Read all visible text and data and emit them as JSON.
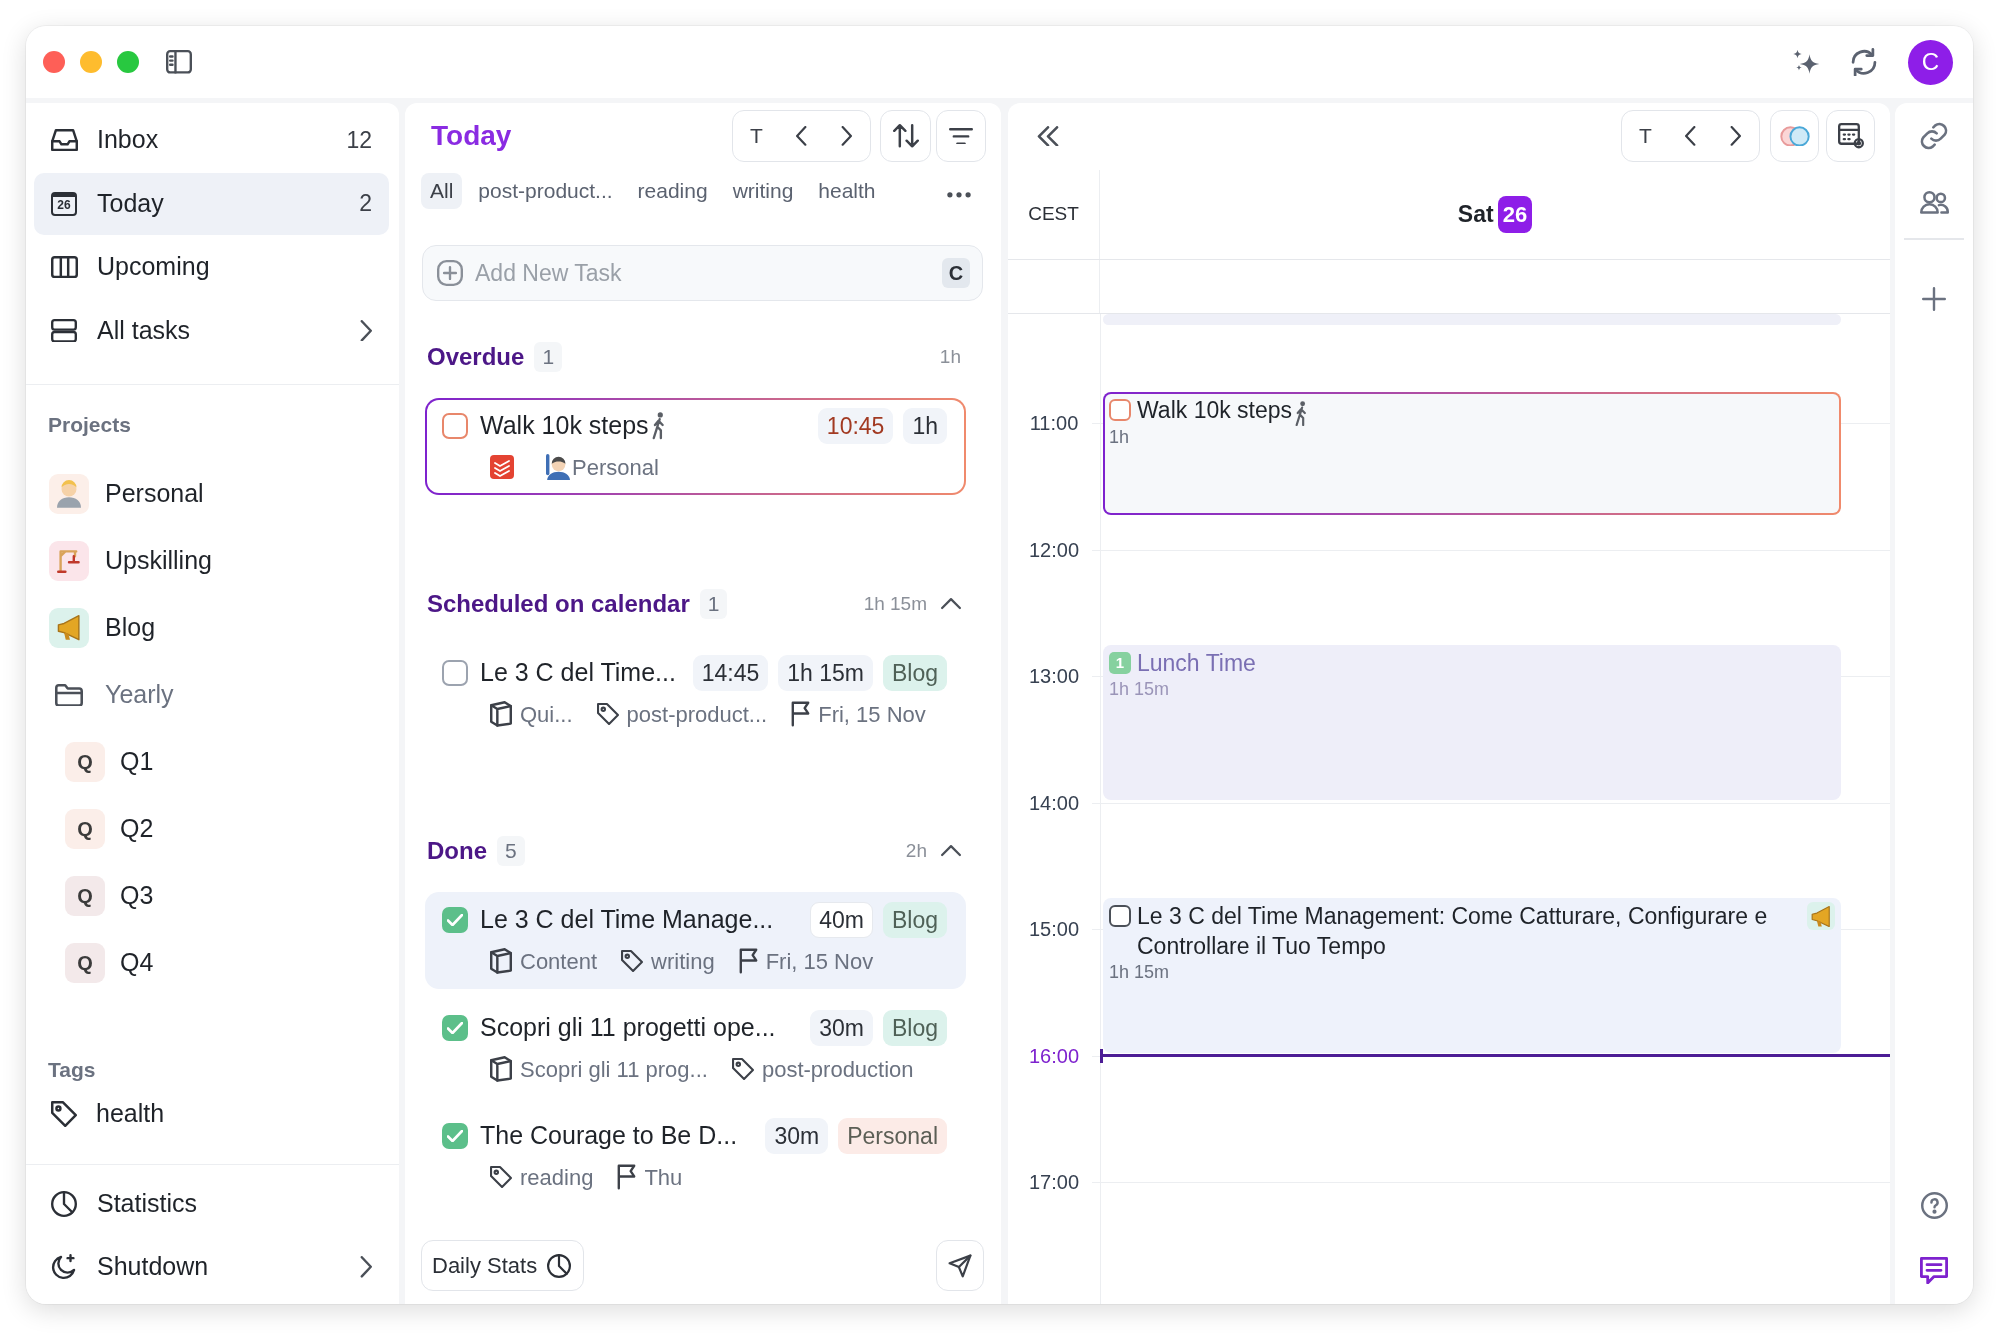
{
  "window": {
    "avatar": "C"
  },
  "sidebar": {
    "nav": [
      {
        "kind": "inbox",
        "label": "Inbox",
        "count": "12",
        "selected": false,
        "expandable": false
      },
      {
        "kind": "today",
        "label": "Today",
        "date": "26",
        "count": "2",
        "selected": true,
        "expandable": false
      },
      {
        "kind": "upcoming",
        "label": "Upcoming",
        "selected": false,
        "expandable": false
      },
      {
        "kind": "all",
        "label": "All tasks",
        "selected": false,
        "expandable": true
      }
    ],
    "projects_heading": "Projects",
    "projects": [
      {
        "kind": "project",
        "label": "Personal",
        "color": "#fcefe9"
      },
      {
        "kind": "project",
        "label": "Upskilling",
        "color": "#fbe5ea"
      },
      {
        "kind": "project",
        "label": "Blog",
        "color": "#dcf2ec"
      },
      {
        "kind": "folder",
        "label": "Yearly",
        "children": [
          {
            "kind": "quarter",
            "label": "Q1",
            "letter": "Q",
            "color": "#fbeee9"
          },
          {
            "kind": "quarter",
            "label": "Q2",
            "letter": "Q",
            "color": "#fbeee9"
          },
          {
            "kind": "quarter",
            "label": "Q3",
            "letter": "Q",
            "color": "#f3e9ea"
          },
          {
            "kind": "quarter",
            "label": "Q4",
            "letter": "Q",
            "color": "#f3e9ea"
          }
        ]
      }
    ],
    "tags_heading": "Tags",
    "tags": [
      {
        "label": "health"
      }
    ],
    "footer": [
      {
        "kind": "statistics",
        "label": "Statistics",
        "expandable": false
      },
      {
        "kind": "shutdown",
        "label": "Shutdown",
        "expandable": true
      }
    ]
  },
  "tasks_panel": {
    "title": "Today",
    "today_button": "T",
    "filters": [
      {
        "label": "All",
        "selected": true
      },
      {
        "label": "post-product...",
        "selected": false
      },
      {
        "label": "reading",
        "selected": false
      },
      {
        "label": "writing",
        "selected": false
      },
      {
        "label": "health",
        "selected": false
      }
    ],
    "add_task": {
      "placeholder": "Add New Task",
      "shortcut": "C"
    },
    "sections": [
      {
        "title": "Overdue",
        "count": "1",
        "total": "1h",
        "collapsible": false,
        "tasks": [
          {
            "title": "Walk 10k steps",
            "has_emoji": true,
            "checked": false,
            "overdue": true,
            "selected": false,
            "pills": [
              {
                "kind": "time",
                "text": "10:45"
              },
              {
                "kind": "duration",
                "text": "1h"
              }
            ],
            "meta": [
              {
                "kind": "source"
              },
              {
                "kind": "project",
                "text": "Personal"
              }
            ]
          }
        ]
      },
      {
        "title": "Scheduled on calendar",
        "count": "1",
        "total": "1h 15m",
        "collapsible": true,
        "expanded": true,
        "tasks": [
          {
            "title": "Le 3 C del Time...",
            "has_emoji": false,
            "checked": false,
            "overdue": false,
            "selected": false,
            "pills": [
              {
                "kind": "time",
                "text": "14:45"
              },
              {
                "kind": "duration",
                "text": "1h 15m"
              },
              {
                "kind": "project",
                "text": "Blog",
                "color": "#dcf2ec"
              }
            ],
            "meta": [
              {
                "kind": "note",
                "text": "Qui..."
              },
              {
                "kind": "tag",
                "text": "post-product..."
              },
              {
                "kind": "date",
                "text": "Fri, 15 Nov"
              }
            ]
          }
        ]
      },
      {
        "title": "Done",
        "count": "5",
        "total": "2h",
        "collapsible": true,
        "expanded": true,
        "tasks": [
          {
            "title": "Le 3 C del Time Manage...",
            "has_emoji": false,
            "checked": true,
            "overdue": false,
            "selected": true,
            "pills": [
              {
                "kind": "duration",
                "text": "40m"
              },
              {
                "kind": "project",
                "text": "Blog",
                "color": "#dcf2ec"
              }
            ],
            "meta": [
              {
                "kind": "note",
                "text": "Content"
              },
              {
                "kind": "tag",
                "text": "writing"
              },
              {
                "kind": "date",
                "text": "Fri, 15 Nov"
              }
            ]
          },
          {
            "title": "Scopri gli 11 progetti ope...",
            "has_emoji": false,
            "checked": true,
            "overdue": false,
            "selected": false,
            "pills": [
              {
                "kind": "duration",
                "text": "30m"
              },
              {
                "kind": "project",
                "text": "Blog",
                "color": "#dcf2ec"
              }
            ],
            "meta": [
              {
                "kind": "note",
                "text": "Scopri gli 11 prog..."
              },
              {
                "kind": "tag",
                "text": "post-production"
              }
            ]
          },
          {
            "title": "The Courage to Be D...",
            "has_emoji": false,
            "checked": true,
            "overdue": false,
            "selected": false,
            "pills": [
              {
                "kind": "duration",
                "text": "30m"
              },
              {
                "kind": "project",
                "text": "Personal",
                "color": "#fcebe7"
              }
            ],
            "meta": [
              {
                "kind": "tag",
                "text": "reading"
              },
              {
                "kind": "date",
                "text": "Thu"
              }
            ]
          }
        ]
      }
    ],
    "stats_button": "Daily Stats"
  },
  "calendar": {
    "today_button": "T",
    "timezone": "CEST",
    "day_name": "Sat",
    "day_number": "26",
    "hours": [
      {
        "label": "11:00",
        "current": false
      },
      {
        "label": "12:00",
        "current": false
      },
      {
        "label": "13:00",
        "current": false
      },
      {
        "label": "14:00",
        "current": false
      },
      {
        "label": "15:00",
        "current": false
      },
      {
        "label": "16:00",
        "current": true
      },
      {
        "label": "17:00",
        "current": false
      }
    ],
    "events": [
      {
        "kind": "block"
      },
      {
        "kind": "task",
        "title": "Walk 10k steps",
        "has_emoji": true,
        "has_project_icon": false,
        "checked": false,
        "overdue": true,
        "duration": "1h"
      },
      {
        "kind": "event",
        "title": "Lunch Time",
        "badge": "1",
        "duration": "1h 15m"
      },
      {
        "kind": "task",
        "title": "Le 3 C del Time Management: Come Catturare, Configurare e Controllare il Tuo Tempo",
        "has_emoji": false,
        "has_project_icon": true,
        "checked": false,
        "overdue": false,
        "duration": "1h 15m"
      }
    ]
  }
}
